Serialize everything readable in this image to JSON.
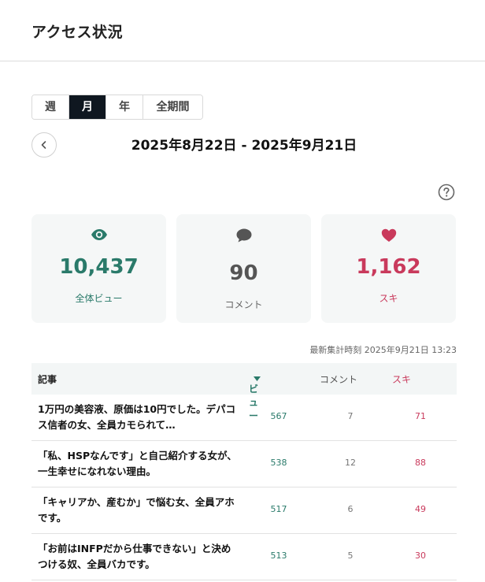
{
  "header": {
    "title": "アクセス状況"
  },
  "period_tabs": [
    {
      "label": "週",
      "active": false
    },
    {
      "label": "月",
      "active": true
    },
    {
      "label": "年",
      "active": false
    },
    {
      "label": "全期間",
      "active": false
    }
  ],
  "date_range": "2025年8月22日 - 2025年9月21日",
  "stats": {
    "views": {
      "icon": "eye-icon",
      "value": "10,437",
      "label": "全体ビュー"
    },
    "comments": {
      "icon": "speech-bubble-icon",
      "value": "90",
      "label": "コメント"
    },
    "likes": {
      "icon": "heart-icon",
      "value": "1,162",
      "label": "スキ"
    }
  },
  "last_updated": "最新集計時刻 2025年9月21日 13:23",
  "table": {
    "headers": {
      "article": "記事",
      "views": "ビュー",
      "comments": "コメント",
      "likes": "スキ"
    },
    "sorted_by": "views",
    "rows": [
      {
        "title": "1万円の美容液、原価は10円でした。デパコス信者の女、全員カモられて…",
        "views": "567",
        "comments": "7",
        "likes": "71"
      },
      {
        "title": "「私、HSPなんです」と自己紹介する女が、一生幸せになれない理由。",
        "views": "538",
        "comments": "12",
        "likes": "88"
      },
      {
        "title": "「キャリアか、産むか」で悩む女、全員アホです。",
        "views": "517",
        "comments": "6",
        "likes": "49"
      },
      {
        "title": "「お前はINFPだから仕事できない」と決めつける奴、全員バカです。",
        "views": "513",
        "comments": "5",
        "likes": "30"
      }
    ]
  },
  "colors": {
    "views": "#2a7a6a",
    "likes": "#c93a5c",
    "active_tab": "#0f1720"
  }
}
